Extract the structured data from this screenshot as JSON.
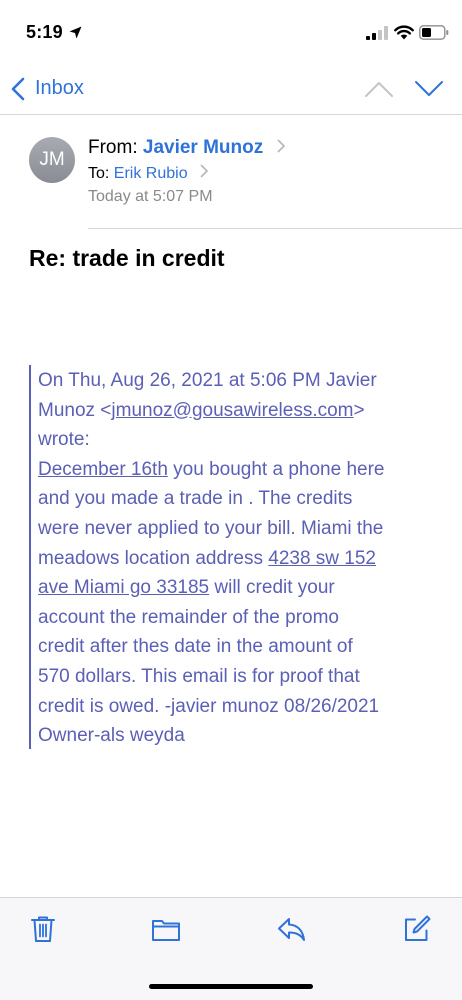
{
  "status_bar": {
    "time": "5:19"
  },
  "nav": {
    "back_label": "Inbox"
  },
  "message": {
    "avatar_initials": "JM",
    "from_label": "From:",
    "sender": "Javier Munoz",
    "to_label": "To:",
    "recipient": "Erik Rubio",
    "date": "Today at 5:07 PM",
    "subject": "Re: trade in credit"
  },
  "quote": {
    "line1": "On Thu, Aug 26, 2021 at 5:06 PM Javier",
    "line2_pre": "Munoz <",
    "email": "jmunoz@gousawireless.com",
    "line2_post": ">",
    "line3": "wrote:",
    "date_link": "December 16th",
    "line4_post": " you bought a phone here",
    "line5": "and you made a trade in . The credits",
    "line6": "were never applied to your bill. Miami the",
    "line7_pre": "meadows location address ",
    "addr_part1": "4238 sw 152",
    "addr_part2": "ave Miami go 33185",
    "line8_post": " will credit your",
    "line9": "account the remainder of the promo",
    "line10": "credit after thes date in the amount of",
    "line11": "570 dollars. This email is for proof that",
    "line12": "credit is owed. -javier munoz 08/26/2021",
    "line13": "Owner-als weyda"
  },
  "colors": {
    "accent": "#2f73d8",
    "quote_text": "#5b5fb5",
    "secondary_text": "#8a8a8e"
  },
  "icons": {
    "status": [
      "location-arrow-icon",
      "signal-icon",
      "wifi-icon",
      "battery-icon"
    ],
    "toolbar": [
      "trash-icon",
      "folder-icon",
      "reply-icon",
      "compose-icon"
    ]
  }
}
